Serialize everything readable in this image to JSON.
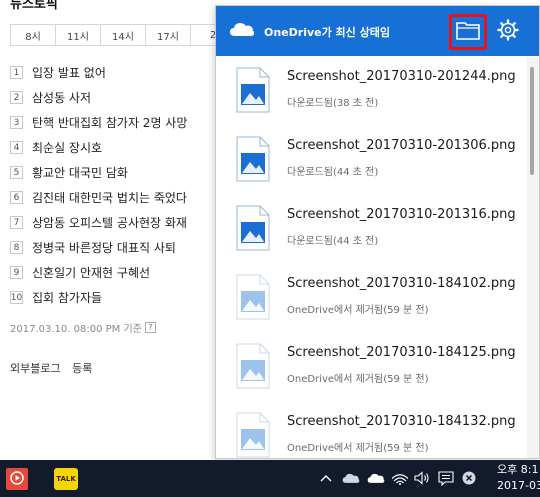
{
  "background_page": {
    "section_title": "뉴스토픽",
    "hour_tabs": [
      "8시",
      "11시",
      "14시",
      "17시",
      "2"
    ],
    "ranks": [
      {
        "num": "1",
        "text": "입장 발표 없어"
      },
      {
        "num": "2",
        "text": "삼성동 사저"
      },
      {
        "num": "3",
        "text": "탄핵 반대집회 참가자 2명 사망"
      },
      {
        "num": "4",
        "text": "최순실 장시호"
      },
      {
        "num": "5",
        "text": "황교안 대국민 담화"
      },
      {
        "num": "6",
        "text": "김진태 대한민국 법치는 죽었다"
      },
      {
        "num": "7",
        "text": "상암동 오피스텔 공사현장 화재"
      },
      {
        "num": "8",
        "text": "정병국 바른정당 대표직 사퇴"
      },
      {
        "num": "9",
        "text": "신혼일기 안재현 구혜선"
      },
      {
        "num": "10",
        "text": "집회 참가자들"
      }
    ],
    "update_time": "2017.03.10. 08:00 PM 기준",
    "help_label": "?",
    "blog_links": [
      "외부블로그",
      "등록"
    ]
  },
  "onedrive": {
    "title": "OneDrive가 최신 상태임",
    "accent": "#1670d6",
    "highlight": "#e4141b",
    "icons": [
      "onedrive-cloud-icon",
      "folder-icon",
      "gear-icon",
      "image-file-icon"
    ],
    "files": [
      {
        "name": "Screenshot_20170310-201244.png",
        "status": "다운로드됨(38 초 전)"
      },
      {
        "name": "Screenshot_20170310-201306.png",
        "status": "다운로드됨(44 초 전)"
      },
      {
        "name": "Screenshot_20170310-201316.png",
        "status": "다운로드됨(44 초 전)"
      },
      {
        "name": "Screenshot_20170310-184102.png",
        "status": "OneDrive에서 제거됨(59 분 전)"
      },
      {
        "name": "Screenshot_20170310-184125.png",
        "status": "OneDrive에서 제거됨(59 분 전)"
      },
      {
        "name": "Screenshot_20170310-184132.png",
        "status": "OneDrive에서 제거됨(59 분 전)"
      }
    ]
  },
  "taskbar": {
    "kakao_label": "TALK",
    "clock_time": "오후 8:1",
    "clock_date": "2017-03-",
    "tray_icons": [
      "chevron-up-icon",
      "onedrive-tray-icon",
      "onedrive-tray-icon-2",
      "wifi-icon",
      "volume-icon",
      "notification-icon",
      "close-circle-icon"
    ]
  }
}
